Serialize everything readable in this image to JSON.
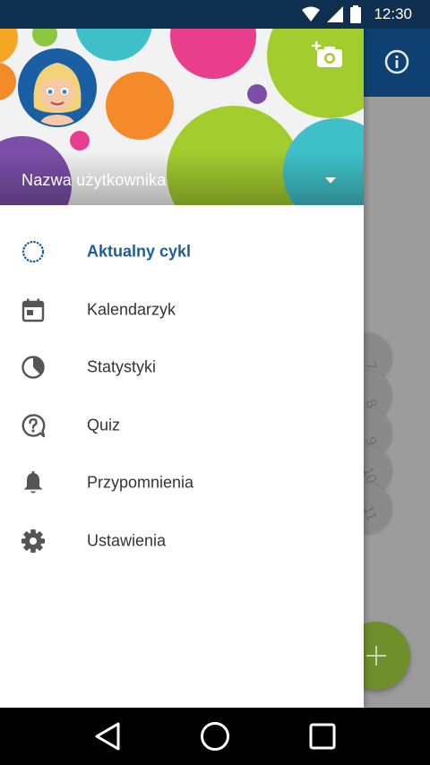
{
  "status_bar": {
    "time": "12:30"
  },
  "drawer": {
    "username": "Nazwa użytkownika",
    "items": [
      {
        "label": "Aktualny cykl",
        "icon": "circle-outline-icon",
        "active": true
      },
      {
        "label": "Kalendarzyk",
        "icon": "calendar-icon",
        "active": false
      },
      {
        "label": "Statystyki",
        "icon": "pie-chart-icon",
        "active": false
      },
      {
        "label": "Quiz",
        "icon": "question-bubble-icon",
        "active": false
      },
      {
        "label": "Przypomnienia",
        "icon": "bell-icon",
        "active": false
      },
      {
        "label": "Ustawienia",
        "icon": "gear-icon",
        "active": false
      }
    ]
  },
  "background": {
    "cycle_days": [
      "7",
      "8",
      "9",
      "10",
      "11"
    ]
  },
  "colors": {
    "accent": "#1b5e99",
    "toolbar": "#0e4171",
    "fab": "#6e8f2c"
  }
}
